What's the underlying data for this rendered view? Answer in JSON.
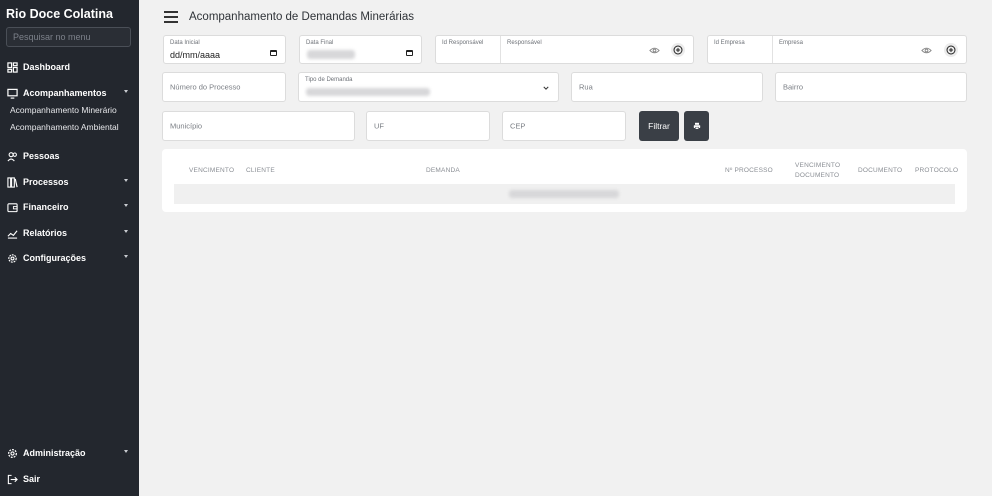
{
  "sidebar": {
    "brand": "Rio Doce Colatina",
    "search_placeholder": "Pesquisar no menu",
    "items": [
      {
        "label": "Dashboard"
      },
      {
        "label": "Acompanhamentos"
      },
      {
        "label": "Pessoas"
      },
      {
        "label": "Processos"
      },
      {
        "label": "Financeiro"
      },
      {
        "label": "Relatórios"
      },
      {
        "label": "Configurações"
      }
    ],
    "sub_items": [
      {
        "label": "Acompanhamento Minerário"
      },
      {
        "label": "Acompanhamento Ambiental"
      }
    ],
    "bottom": [
      {
        "label": "Administração"
      },
      {
        "label": "Sair"
      }
    ]
  },
  "header": {
    "title": "Acompanhamento de Demandas Minerárias"
  },
  "filters": {
    "data_inicial": {
      "label": "Data Inicial",
      "value": "dd/mm/aaaa"
    },
    "data_final": {
      "label": "Data Final"
    },
    "id_responsavel": {
      "label": "Id Responsável"
    },
    "responsavel": {
      "label": "Responsável"
    },
    "id_empresa": {
      "label": "Id Empresa"
    },
    "empresa": {
      "label": "Empresa"
    },
    "numero_processo": {
      "placeholder": "Número do Processo"
    },
    "tipo_demanda": {
      "label": "Tipo de Demanda"
    },
    "rua": {
      "placeholder": "Rua"
    },
    "bairro": {
      "placeholder": "Bairro"
    },
    "municipio": {
      "placeholder": "Município"
    },
    "uf": {
      "placeholder": "UF"
    },
    "cep": {
      "placeholder": "CEP"
    },
    "filter_button": "Filtrar"
  },
  "table": {
    "columns": {
      "vencimento": "VENCIMENTO",
      "cliente": "CLIENTE",
      "demanda": "DEMANDA",
      "processo": "Nº PROCESSO",
      "venc_doc_1": "VENCIMENTO",
      "venc_doc_2": "DOCUMENTO",
      "documento": "DOCUMENTO",
      "protocolo": "PROTOCOLO"
    }
  }
}
